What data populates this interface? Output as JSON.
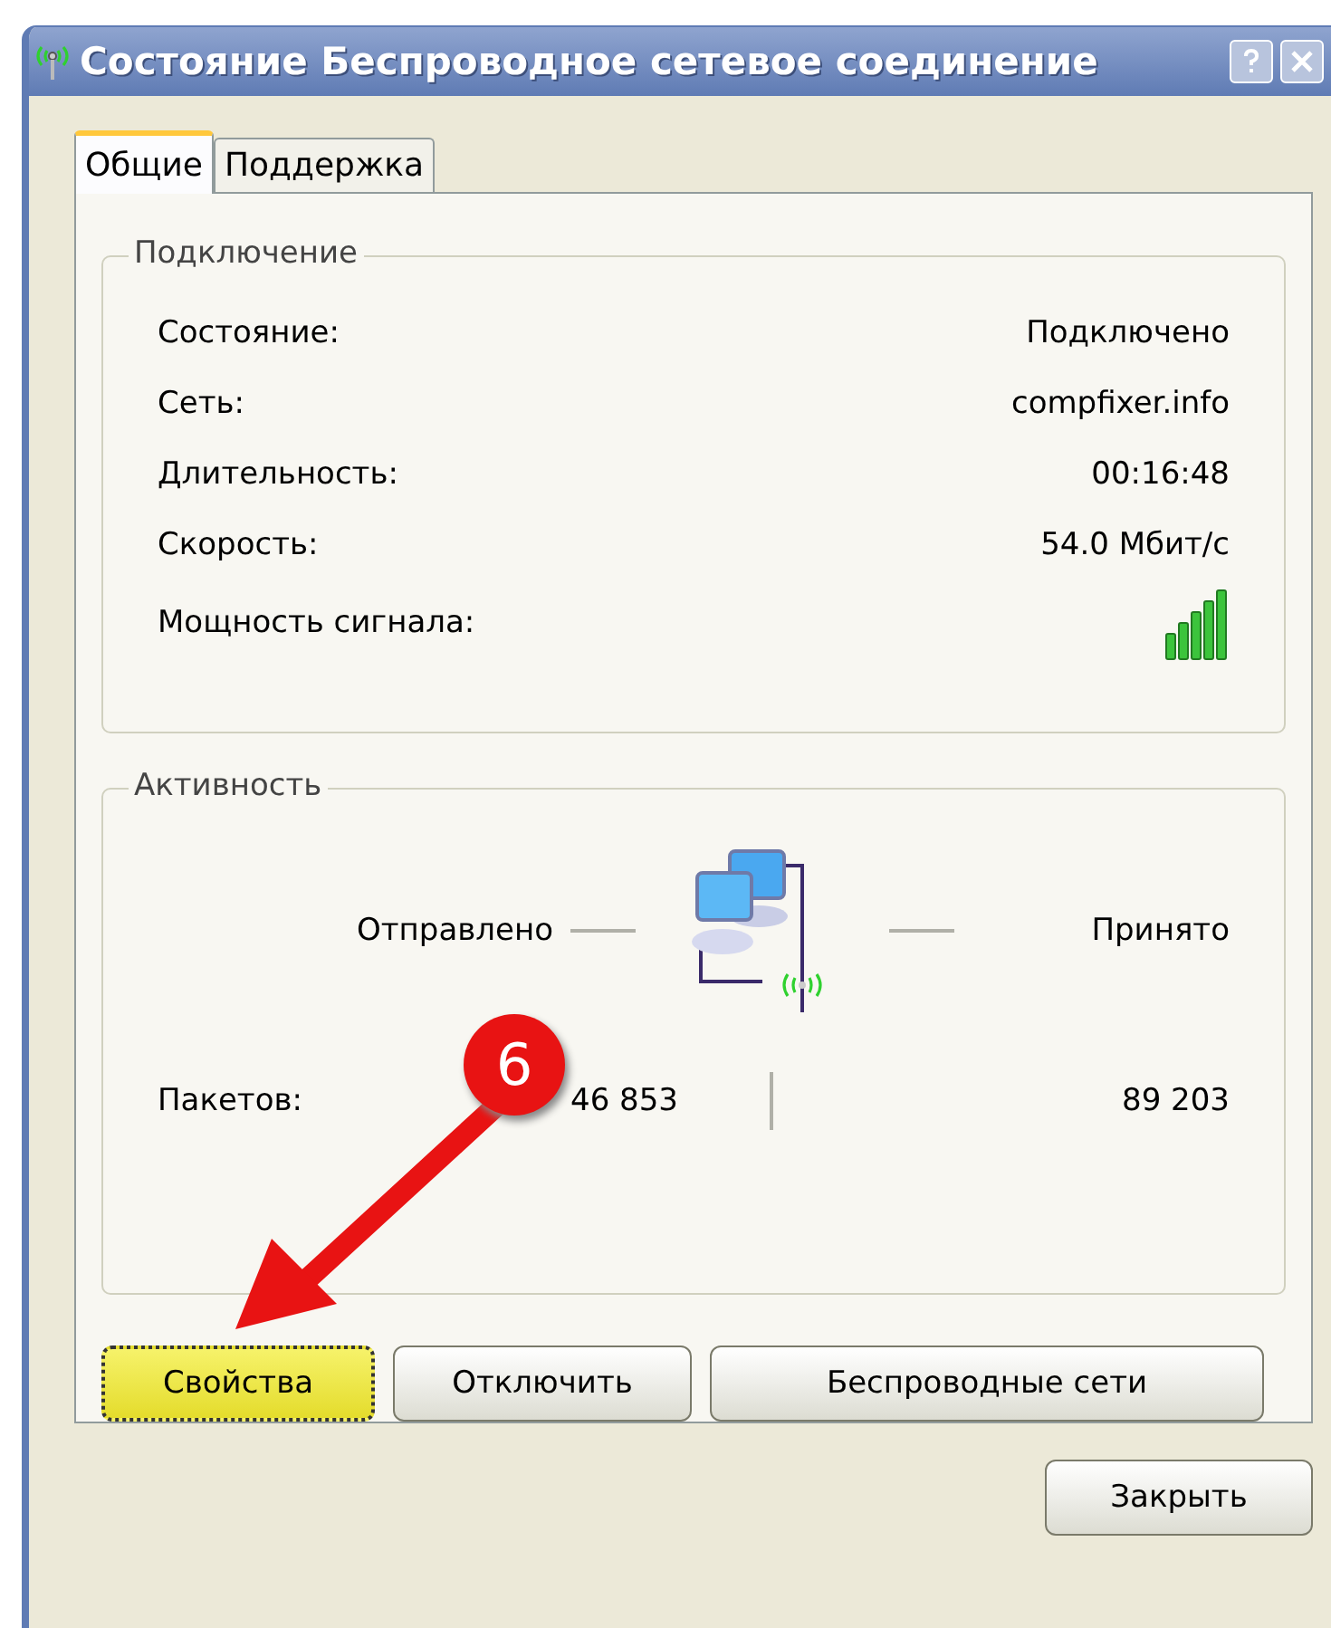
{
  "window": {
    "title": "Состояние Беспроводное сетевое соединение"
  },
  "tabs": [
    {
      "label": "Общие",
      "selected": true
    },
    {
      "label": "Поддержка",
      "selected": false
    }
  ],
  "connection": {
    "title": "Подключение",
    "rows": [
      {
        "label": "Состояние:",
        "value": "Подключено"
      },
      {
        "label": "Сеть:",
        "value": "compfixer.info"
      },
      {
        "label": "Длительность:",
        "value": "00:16:48"
      },
      {
        "label": "Скорость:",
        "value": "54.0 Мбит/с"
      }
    ],
    "signal_label": "Мощность сигнала:"
  },
  "activity": {
    "title": "Активность",
    "sent_label": "Отправлено",
    "received_label": "Принято",
    "packets_label": "Пакетов:",
    "sent": "46 853",
    "received": "89 203"
  },
  "buttons": [
    {
      "label": "Свойства",
      "highlighted": true
    },
    {
      "label": "Отключить",
      "highlighted": false
    },
    {
      "label": "Беспроводные сети",
      "highlighted": false
    }
  ],
  "close_button": "Закрыть",
  "annotation": {
    "badge": "6"
  }
}
